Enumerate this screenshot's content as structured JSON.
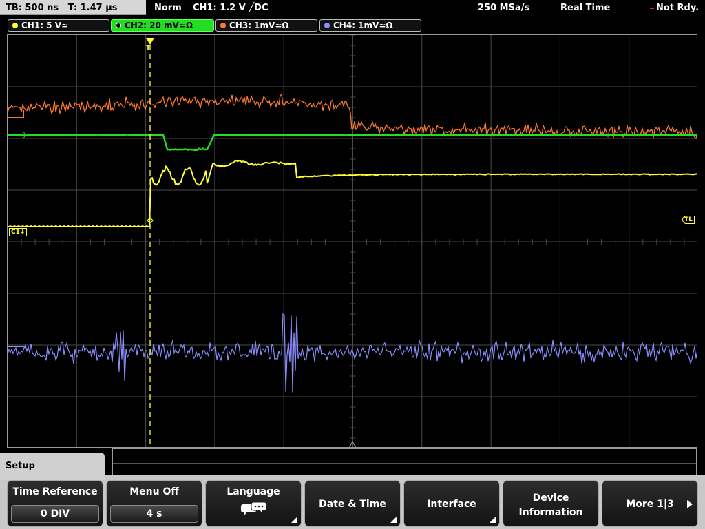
{
  "header": {
    "timebase": "TB: 500 ns",
    "trigger_time": "T: 1.47 µs",
    "mode": "Norm",
    "trigger_info": "CH1: 1.2 V ╱DC",
    "sample_rate": "250 MSa/s",
    "acq_mode": "Real Time",
    "status": "Not Rdy."
  },
  "channels": [
    {
      "label": "CH1: 5 V≃",
      "color": "#ffff33"
    },
    {
      "label": "CH2: 20 mV≃Ω",
      "color": "#22dd22"
    },
    {
      "label": "CH3: 1mV≃Ω",
      "color": "#ff7a2a"
    },
    {
      "label": "CH4: 1mV≃Ω",
      "color": "#8c8cff"
    }
  ],
  "markers": {
    "c1": "C1↓",
    "tl": "TL",
    "trigger": "T"
  },
  "menu": {
    "title": "Setup",
    "time_reference": {
      "label": "Time Reference",
      "value": "0 DIV"
    },
    "menu_off": {
      "label": "Menu Off",
      "value": "4 s"
    },
    "language": {
      "label": "Language"
    },
    "date_time": {
      "label": "Date & Time"
    },
    "interface": {
      "label": "Interface"
    },
    "device_info": {
      "line1": "Device",
      "line2": "Information"
    },
    "more": {
      "label": "More 1|3"
    }
  },
  "colors": {
    "ch1": "#ffff33",
    "ch2": "#22dd22",
    "ch3": "#ff7a2a",
    "ch4": "#8c8cff",
    "grid": "#4a4a4a"
  }
}
